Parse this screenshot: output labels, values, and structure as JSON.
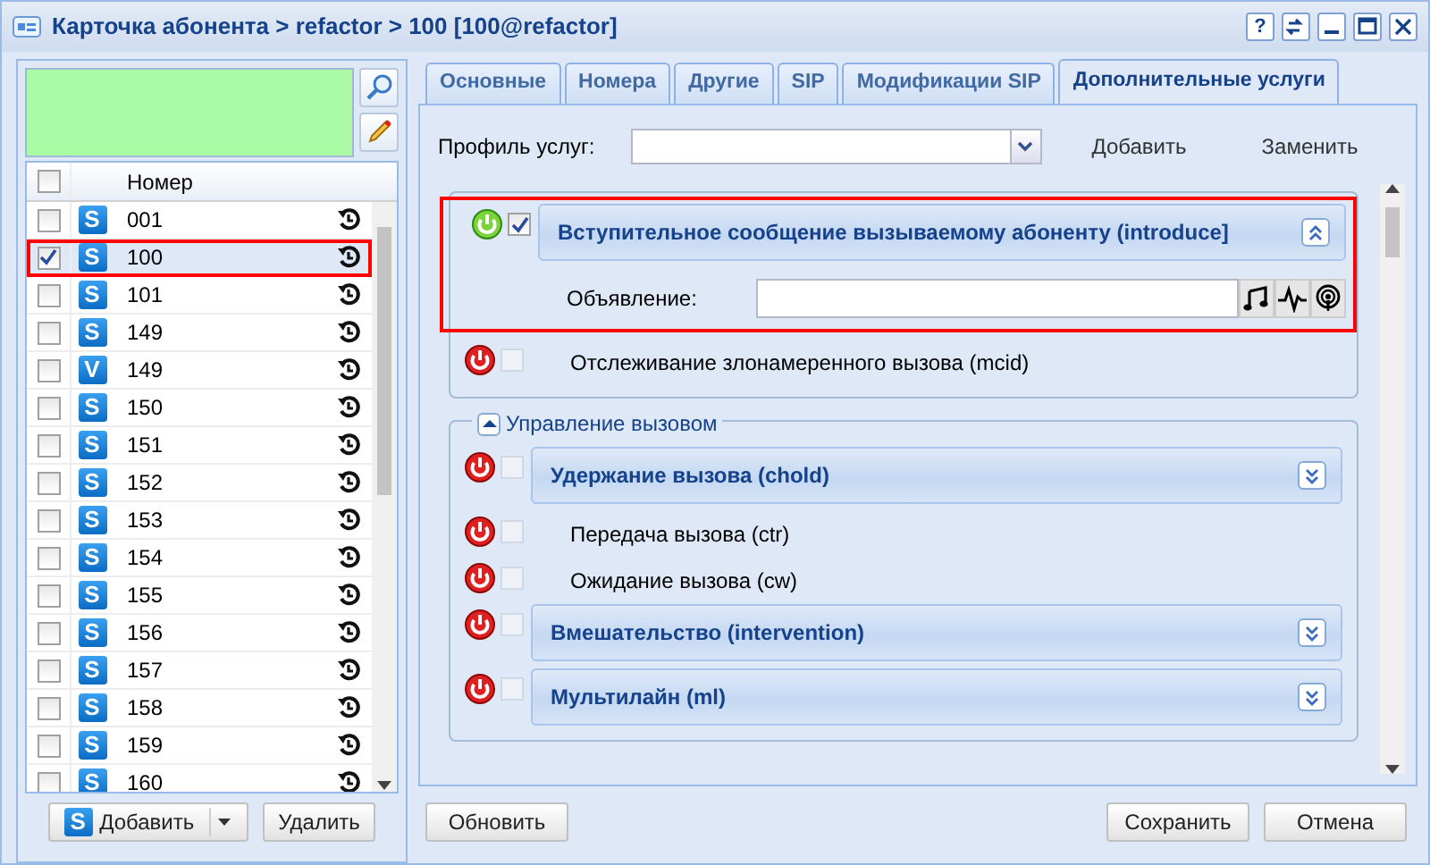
{
  "window": {
    "title": "Карточка абонента > refactor > 100 [100@refactor]",
    "tools": [
      {
        "kind": "help",
        "label": "?"
      },
      {
        "kind": "refresh"
      },
      {
        "kind": "minimize"
      },
      {
        "kind": "maximize"
      },
      {
        "kind": "close"
      }
    ]
  },
  "subscribers": {
    "columns": [
      "Номер"
    ],
    "all_checked": false,
    "rows": [
      {
        "number": "001",
        "badge": "S",
        "checked": false,
        "selected": false,
        "highlighted": false
      },
      {
        "number": "100",
        "badge": "S",
        "checked": true,
        "selected": true,
        "highlighted": true
      },
      {
        "number": "101",
        "badge": "S",
        "checked": false,
        "selected": false,
        "highlighted": false
      },
      {
        "number": "149",
        "badge": "S",
        "checked": false,
        "selected": false,
        "highlighted": false
      },
      {
        "number": "149",
        "badge": "V",
        "checked": false,
        "selected": false,
        "highlighted": false
      },
      {
        "number": "150",
        "badge": "S",
        "checked": false,
        "selected": false,
        "highlighted": false
      },
      {
        "number": "151",
        "badge": "S",
        "checked": false,
        "selected": false,
        "highlighted": false
      },
      {
        "number": "152",
        "badge": "S",
        "checked": false,
        "selected": false,
        "highlighted": false
      },
      {
        "number": "153",
        "badge": "S",
        "checked": false,
        "selected": false,
        "highlighted": false
      },
      {
        "number": "154",
        "badge": "S",
        "checked": false,
        "selected": false,
        "highlighted": false
      },
      {
        "number": "155",
        "badge": "S",
        "checked": false,
        "selected": false,
        "highlighted": false
      },
      {
        "number": "156",
        "badge": "S",
        "checked": false,
        "selected": false,
        "highlighted": false
      },
      {
        "number": "157",
        "badge": "S",
        "checked": false,
        "selected": false,
        "highlighted": false
      },
      {
        "number": "158",
        "badge": "S",
        "checked": false,
        "selected": false,
        "highlighted": false
      },
      {
        "number": "159",
        "badge": "S",
        "checked": false,
        "selected": false,
        "highlighted": false
      },
      {
        "number": "160",
        "badge": "S",
        "checked": false,
        "selected": false,
        "highlighted": false
      }
    ],
    "add_button": {
      "label": "Добавить",
      "badge": "S"
    },
    "delete_button": {
      "label": "Удалить"
    }
  },
  "tabs": [
    {
      "label": "Основные",
      "selected": false
    },
    {
      "label": "Номера",
      "selected": false
    },
    {
      "label": "Другие",
      "selected": false
    },
    {
      "label": "SIP",
      "selected": false
    },
    {
      "label": "Модификации SIP",
      "selected": false
    },
    {
      "label": "Дополнительные услуги",
      "selected": true
    }
  ],
  "profile": {
    "label": "Профиль услуг:",
    "add": "Добавить",
    "replace": "Заменить"
  },
  "services": [
    {
      "kind": "box",
      "children": [
        {
          "kind": "panel",
          "title": "Вступительное сообщение вызываемому абоненту (introduce]",
          "enabled": true,
          "checked": true,
          "expanded": true,
          "highlighted": true,
          "fields": [
            {
              "label": "Объявление:"
            }
          ]
        },
        {
          "kind": "plain",
          "title": "Отслеживание злонамеренного вызова (mcid)",
          "enabled": false,
          "checked": false,
          "highlighted": false
        }
      ]
    },
    {
      "kind": "group",
      "title": "Управление вызовом",
      "expanded": true,
      "children": [
        {
          "kind": "panel",
          "title": "Удержание вызова (chold)",
          "enabled": false,
          "checked": false,
          "expanded": false,
          "highlighted": false
        },
        {
          "kind": "plain",
          "title": "Передача вызова (ctr)",
          "enabled": false,
          "checked": false,
          "highlighted": false
        },
        {
          "kind": "plain",
          "title": "Ожидание вызова (cw)",
          "enabled": false,
          "checked": false,
          "highlighted": false
        },
        {
          "kind": "panel",
          "title": "Вмешательство (intervention)",
          "enabled": false,
          "checked": false,
          "expanded": false,
          "highlighted": false
        },
        {
          "kind": "panel",
          "title": "Мультилайн (ml)",
          "enabled": false,
          "checked": false,
          "expanded": false,
          "highlighted": false
        }
      ]
    }
  ],
  "footer": {
    "refresh": "Обновить",
    "save": "Сохранить",
    "cancel": "Отмена"
  }
}
